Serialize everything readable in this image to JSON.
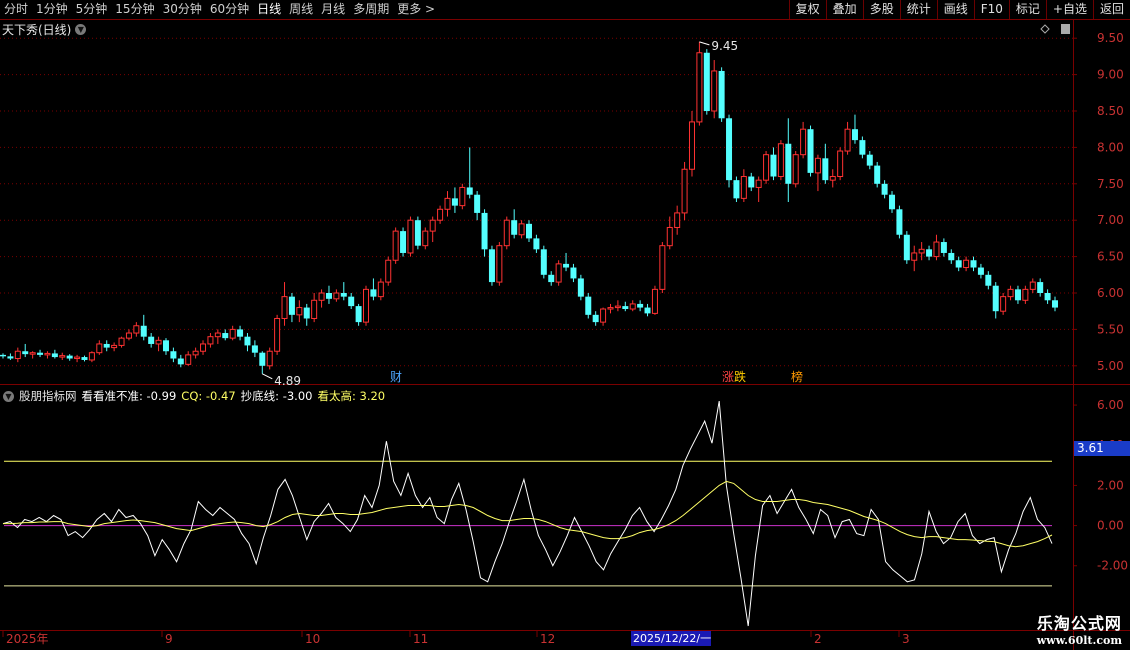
{
  "toolbar": {
    "periods": [
      "分时",
      "1分钟",
      "5分钟",
      "15分钟",
      "30分钟",
      "60分钟",
      "日线",
      "周线",
      "月线",
      "多周期",
      "更多 >"
    ],
    "active_period": "日线",
    "buttons": [
      "复权",
      "叠加",
      "多股",
      "统计",
      "画线",
      "F10",
      "标记",
      "+自选",
      "返回"
    ]
  },
  "chart_title": "天下秀(日线)",
  "price_labels": {
    "high": "9.45",
    "low": "4.89"
  },
  "markers": [
    "财",
    "涨",
    "跌",
    "榜"
  ],
  "indicator": {
    "name": "股朋指标网",
    "line1_label": "看看准不准: -0.99",
    "line2_label": "CQ: -0.47",
    "line3_label": "抄底线: -3.00",
    "line4_label": "看太高: 3.20",
    "value_badge": "3.61"
  },
  "date_axis": {
    "labels": [
      "2025年",
      "9",
      "10",
      "11",
      "12",
      "2",
      "3"
    ],
    "selected": "2025/12/22/一"
  },
  "watermark": {
    "line1": "乐淘公式网",
    "line2": "www.60lt.com"
  },
  "colors": {
    "up": "#ff3232",
    "down": "#54ffff",
    "grid": "#7a0000",
    "yellow": "#ffff66",
    "purple": "#cc33cc"
  },
  "chart_data": [
    {
      "type": "candlestick",
      "title": "天下秀(日线)",
      "y_ticks": [
        5.0,
        5.5,
        6.0,
        6.5,
        7.0,
        7.5,
        8.0,
        8.5,
        9.0,
        9.5
      ],
      "ylim": [
        4.75,
        9.75
      ],
      "candles": [
        [
          5.15,
          5.17,
          5.1,
          5.13
        ],
        [
          5.13,
          5.17,
          5.08,
          5.1
        ],
        [
          5.1,
          5.25,
          5.05,
          5.2
        ],
        [
          5.2,
          5.3,
          5.12,
          5.16
        ],
        [
          5.16,
          5.2,
          5.1,
          5.18
        ],
        [
          5.18,
          5.22,
          5.12,
          5.15
        ],
        [
          5.15,
          5.2,
          5.1,
          5.17
        ],
        [
          5.17,
          5.22,
          5.1,
          5.12
        ],
        [
          5.12,
          5.18,
          5.08,
          5.14
        ],
        [
          5.14,
          5.16,
          5.07,
          5.1
        ],
        [
          5.1,
          5.15,
          5.05,
          5.12
        ],
        [
          5.12,
          5.14,
          5.06,
          5.08
        ],
        [
          5.08,
          5.2,
          5.05,
          5.18
        ],
        [
          5.18,
          5.35,
          5.15,
          5.3
        ],
        [
          5.3,
          5.35,
          5.2,
          5.25
        ],
        [
          5.25,
          5.32,
          5.2,
          5.28
        ],
        [
          5.28,
          5.4,
          5.25,
          5.38
        ],
        [
          5.38,
          5.5,
          5.35,
          5.45
        ],
        [
          5.45,
          5.6,
          5.4,
          5.55
        ],
        [
          5.55,
          5.7,
          5.35,
          5.4
        ],
        [
          5.4,
          5.45,
          5.25,
          5.3
        ],
        [
          5.3,
          5.4,
          5.2,
          5.35
        ],
        [
          5.35,
          5.38,
          5.15,
          5.2
        ],
        [
          5.2,
          5.25,
          5.05,
          5.1
        ],
        [
          5.1,
          5.15,
          4.98,
          5.02
        ],
        [
          5.02,
          5.2,
          5.0,
          5.15
        ],
        [
          5.15,
          5.25,
          5.1,
          5.2
        ],
        [
          5.2,
          5.35,
          5.15,
          5.3
        ],
        [
          5.3,
          5.45,
          5.25,
          5.4
        ],
        [
          5.4,
          5.5,
          5.3,
          5.45
        ],
        [
          5.45,
          5.5,
          5.35,
          5.38
        ],
        [
          5.38,
          5.55,
          5.35,
          5.5
        ],
        [
          5.5,
          5.55,
          5.35,
          5.4
        ],
        [
          5.4,
          5.45,
          5.2,
          5.28
        ],
        [
          5.28,
          5.35,
          5.12,
          5.18
        ],
        [
          5.18,
          5.2,
          4.89,
          5.0
        ],
        [
          5.0,
          5.25,
          4.95,
          5.2
        ],
        [
          5.2,
          5.7,
          5.15,
          5.65
        ],
        [
          5.65,
          6.15,
          5.55,
          5.95
        ],
        [
          5.95,
          6.0,
          5.6,
          5.7
        ],
        [
          5.7,
          5.9,
          5.6,
          5.8
        ],
        [
          5.8,
          5.85,
          5.55,
          5.65
        ],
        [
          5.65,
          6.0,
          5.6,
          5.9
        ],
        [
          5.9,
          6.05,
          5.8,
          6.0
        ],
        [
          6.0,
          6.1,
          5.85,
          5.92
        ],
        [
          5.92,
          6.05,
          5.88,
          6.0
        ],
        [
          6.0,
          6.15,
          5.9,
          5.95
        ],
        [
          5.95,
          6.0,
          5.78,
          5.82
        ],
        [
          5.82,
          5.85,
          5.55,
          5.6
        ],
        [
          5.6,
          6.1,
          5.55,
          6.05
        ],
        [
          6.05,
          6.2,
          5.9,
          5.95
        ],
        [
          5.95,
          6.2,
          5.9,
          6.15
        ],
        [
          6.15,
          6.5,
          6.1,
          6.45
        ],
        [
          6.45,
          6.9,
          6.4,
          6.85
        ],
        [
          6.85,
          6.9,
          6.5,
          6.55
        ],
        [
          6.55,
          7.05,
          6.5,
          7.0
        ],
        [
          7.0,
          7.05,
          6.6,
          6.65
        ],
        [
          6.65,
          6.9,
          6.6,
          6.85
        ],
        [
          6.85,
          7.05,
          6.7,
          7.0
        ],
        [
          7.0,
          7.2,
          6.95,
          7.15
        ],
        [
          7.15,
          7.4,
          7.05,
          7.3
        ],
        [
          7.3,
          7.45,
          7.1,
          7.2
        ],
        [
          7.2,
          7.5,
          7.15,
          7.45
        ],
        [
          7.45,
          8.0,
          7.3,
          7.35
        ],
        [
          7.35,
          7.4,
          7.0,
          7.1
        ],
        [
          7.1,
          7.15,
          6.5,
          6.6
        ],
        [
          6.6,
          6.65,
          6.1,
          6.15
        ],
        [
          6.15,
          6.7,
          6.1,
          6.65
        ],
        [
          6.65,
          7.05,
          6.6,
          7.0
        ],
        [
          7.0,
          7.15,
          6.75,
          6.8
        ],
        [
          6.8,
          7.0,
          6.75,
          6.95
        ],
        [
          6.95,
          7.0,
          6.7,
          6.75
        ],
        [
          6.75,
          6.8,
          6.55,
          6.6
        ],
        [
          6.6,
          6.65,
          6.2,
          6.25
        ],
        [
          6.25,
          6.3,
          6.1,
          6.15
        ],
        [
          6.15,
          6.45,
          6.1,
          6.4
        ],
        [
          6.4,
          6.55,
          6.3,
          6.35
        ],
        [
          6.35,
          6.4,
          6.15,
          6.2
        ],
        [
          6.2,
          6.25,
          5.9,
          5.95
        ],
        [
          5.95,
          6.0,
          5.65,
          5.7
        ],
        [
          5.7,
          5.75,
          5.55,
          5.6
        ],
        [
          5.6,
          5.8,
          5.55,
          5.78
        ],
        [
          5.78,
          5.85,
          5.72,
          5.8
        ],
        [
          5.8,
          5.9,
          5.75,
          5.82
        ],
        [
          5.82,
          5.88,
          5.75,
          5.78
        ],
        [
          5.78,
          5.9,
          5.75,
          5.85
        ],
        [
          5.85,
          5.9,
          5.75,
          5.8
        ],
        [
          5.8,
          5.85,
          5.68,
          5.72
        ],
        [
          5.72,
          6.1,
          5.7,
          6.05
        ],
        [
          6.05,
          6.7,
          6.0,
          6.65
        ],
        [
          6.65,
          7.05,
          6.6,
          6.9
        ],
        [
          6.9,
          7.2,
          6.8,
          7.1
        ],
        [
          7.1,
          7.8,
          7.0,
          7.7
        ],
        [
          7.7,
          8.5,
          7.6,
          8.35
        ],
        [
          8.35,
          9.45,
          8.3,
          9.3
        ],
        [
          9.3,
          9.35,
          8.45,
          8.5
        ],
        [
          8.5,
          9.2,
          8.4,
          9.05
        ],
        [
          9.05,
          9.1,
          8.35,
          8.4
        ],
        [
          8.4,
          8.45,
          7.45,
          7.55
        ],
        [
          7.55,
          7.6,
          7.25,
          7.3
        ],
        [
          7.3,
          7.7,
          7.25,
          7.6
        ],
        [
          7.6,
          7.65,
          7.4,
          7.45
        ],
        [
          7.45,
          7.6,
          7.25,
          7.55
        ],
        [
          7.55,
          7.95,
          7.5,
          7.9
        ],
        [
          7.9,
          8.0,
          7.55,
          7.6
        ],
        [
          7.6,
          8.1,
          7.55,
          8.05
        ],
        [
          8.05,
          8.4,
          7.25,
          7.5
        ],
        [
          7.5,
          7.95,
          7.45,
          7.9
        ],
        [
          7.9,
          8.35,
          7.85,
          8.25
        ],
        [
          8.25,
          8.3,
          7.6,
          7.65
        ],
        [
          7.65,
          7.9,
          7.4,
          7.85
        ],
        [
          7.85,
          8.05,
          7.5,
          7.55
        ],
        [
          7.55,
          7.7,
          7.45,
          7.6
        ],
        [
          7.6,
          8.0,
          7.55,
          7.95
        ],
        [
          7.95,
          8.35,
          7.9,
          8.25
        ],
        [
          8.25,
          8.45,
          8.05,
          8.1
        ],
        [
          8.1,
          8.15,
          7.85,
          7.9
        ],
        [
          7.9,
          7.95,
          7.7,
          7.75
        ],
        [
          7.75,
          7.8,
          7.45,
          7.5
        ],
        [
          7.5,
          7.55,
          7.3,
          7.35
        ],
        [
          7.35,
          7.4,
          7.1,
          7.15
        ],
        [
          7.15,
          7.2,
          6.75,
          6.8
        ],
        [
          6.8,
          6.85,
          6.4,
          6.45
        ],
        [
          6.45,
          6.65,
          6.3,
          6.55
        ],
        [
          6.55,
          6.7,
          6.45,
          6.6
        ],
        [
          6.6,
          6.65,
          6.45,
          6.5
        ],
        [
          6.5,
          6.8,
          6.45,
          6.7
        ],
        [
          6.7,
          6.75,
          6.5,
          6.55
        ],
        [
          6.55,
          6.6,
          6.4,
          6.45
        ],
        [
          6.45,
          6.5,
          6.3,
          6.35
        ],
        [
          6.35,
          6.5,
          6.3,
          6.45
        ],
        [
          6.45,
          6.5,
          6.3,
          6.35
        ],
        [
          6.35,
          6.4,
          6.2,
          6.25
        ],
        [
          6.25,
          6.3,
          6.05,
          6.1
        ],
        [
          6.1,
          6.15,
          5.65,
          5.75
        ],
        [
          5.75,
          6.0,
          5.7,
          5.95
        ],
        [
          5.95,
          6.1,
          5.9,
          6.05
        ],
        [
          6.05,
          6.1,
          5.85,
          5.9
        ],
        [
          5.9,
          6.1,
          5.85,
          6.05
        ],
        [
          6.05,
          6.2,
          6.0,
          6.15
        ],
        [
          6.15,
          6.2,
          5.95,
          6.0
        ],
        [
          6.0,
          6.05,
          5.85,
          5.9
        ],
        [
          5.9,
          5.95,
          5.75,
          5.8
        ]
      ]
    },
    {
      "type": "line",
      "title": "股朋指标网",
      "y_ticks": [
        -2.0,
        0.0,
        2.0,
        4.0,
        6.0
      ],
      "ylim": [
        -5.2,
        7.0
      ],
      "hlines": [
        3.2,
        -3.0,
        0.0
      ],
      "series": [
        {
          "name": "看看准不准",
          "values": [
            0.1,
            0.2,
            -0.1,
            0.3,
            0.2,
            0.4,
            0.2,
            0.5,
            0.3,
            -0.5,
            -0.3,
            -0.6,
            -0.2,
            0.3,
            0.6,
            0.2,
            0.8,
            0.4,
            0.5,
            0.1,
            -0.5,
            -1.5,
            -0.7,
            -1.2,
            -1.8,
            -0.9,
            -0.2,
            1.2,
            0.8,
            0.5,
            0.9,
            0.6,
            0.3,
            -0.4,
            -0.9,
            -1.9,
            -0.6,
            0.5,
            1.8,
            2.3,
            1.5,
            0.4,
            -0.7,
            0.2,
            0.6,
            1.1,
            0.4,
            0.1,
            -0.3,
            0.3,
            1.5,
            0.9,
            2.0,
            4.2,
            2.2,
            1.5,
            2.6,
            1.5,
            0.9,
            1.4,
            0.4,
            0.1,
            1.3,
            2.1,
            0.8,
            -0.8,
            -2.6,
            -2.8,
            -1.8,
            -0.9,
            0.2,
            1.2,
            2.3,
            0.8,
            -0.5,
            -1.2,
            -2.0,
            -1.3,
            -0.5,
            0.4,
            -0.3,
            -1.0,
            -1.8,
            -2.2,
            -1.4,
            -0.8,
            -0.2,
            0.5,
            0.9,
            0.2,
            -0.3,
            0.3,
            1.0,
            1.8,
            3.0,
            3.8,
            4.5,
            5.2,
            4.1,
            6.2,
            2.0,
            -0.4,
            -2.6,
            -5.0,
            -1.5,
            1.0,
            1.5,
            0.6,
            1.2,
            1.8,
            0.9,
            0.3,
            -0.4,
            0.8,
            0.5,
            -0.6,
            0.2,
            0.3,
            -0.4,
            -0.5,
            0.8,
            0.3,
            -1.8,
            -2.2,
            -2.5,
            -2.8,
            -2.7,
            -1.4,
            0.7,
            -0.3,
            -0.9,
            -0.6,
            0.2,
            0.6,
            -0.5,
            -0.9,
            -0.7,
            -0.6,
            -2.3,
            -1.2,
            -0.4,
            0.7,
            1.4,
            0.3,
            -0.1,
            -0.9
          ]
        },
        {
          "name": "CQ",
          "values": [
            0.1,
            0.1,
            0.12,
            0.15,
            0.15,
            0.18,
            0.18,
            0.2,
            0.2,
            0.1,
            0.05,
            0.0,
            -0.05,
            0.0,
            0.1,
            0.15,
            0.2,
            0.25,
            0.28,
            0.25,
            0.2,
            0.15,
            0.05,
            -0.05,
            -0.15,
            -0.2,
            -0.25,
            -0.15,
            -0.05,
            0.05,
            0.1,
            0.15,
            0.18,
            0.15,
            0.1,
            0.0,
            -0.05,
            0.05,
            0.2,
            0.4,
            0.55,
            0.6,
            0.55,
            0.5,
            0.5,
            0.55,
            0.6,
            0.6,
            0.55,
            0.55,
            0.6,
            0.65,
            0.75,
            0.85,
            0.9,
            0.95,
            1.0,
            1.0,
            1.0,
            1.0,
            0.95,
            0.95,
            1.0,
            1.05,
            1.0,
            0.9,
            0.7,
            0.5,
            0.35,
            0.25,
            0.25,
            0.3,
            0.35,
            0.35,
            0.3,
            0.2,
            0.05,
            -0.1,
            -0.2,
            -0.25,
            -0.3,
            -0.4,
            -0.5,
            -0.6,
            -0.65,
            -0.65,
            -0.6,
            -0.5,
            -0.35,
            -0.25,
            -0.2,
            -0.1,
            0.05,
            0.25,
            0.5,
            0.8,
            1.1,
            1.4,
            1.7,
            2.0,
            2.2,
            2.1,
            1.8,
            1.5,
            1.3,
            1.2,
            1.2,
            1.2,
            1.25,
            1.3,
            1.3,
            1.25,
            1.15,
            1.1,
            1.05,
            0.95,
            0.85,
            0.75,
            0.6,
            0.45,
            0.35,
            0.25,
            0.1,
            -0.1,
            -0.3,
            -0.45,
            -0.55,
            -0.6,
            -0.55,
            -0.55,
            -0.6,
            -0.65,
            -0.7,
            -0.7,
            -0.72,
            -0.75,
            -0.78,
            -0.8,
            -0.9,
            -1.0,
            -1.05,
            -1.0,
            -0.9,
            -0.8,
            -0.65,
            -0.47
          ]
        }
      ]
    }
  ]
}
